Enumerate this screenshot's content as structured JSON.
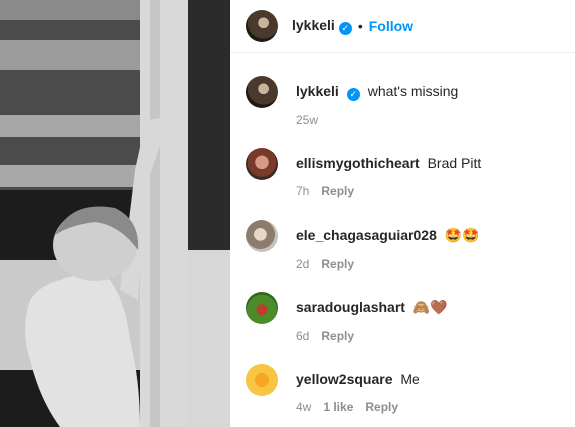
{
  "header": {
    "username": "lykkeli",
    "separator": "•",
    "follow_label": "Follow"
  },
  "caption": {
    "username": "lykkeli",
    "text": "what's missing",
    "time": "25w"
  },
  "comments": [
    {
      "username": "ellismygothicheart",
      "text": "Brad Pitt",
      "time": "7h",
      "likes": "",
      "reply_label": "Reply"
    },
    {
      "username": "ele_chagasaguiar028",
      "text": "🤩🤩",
      "time": "2d",
      "likes": "",
      "reply_label": "Reply"
    },
    {
      "username": "saradouglashart",
      "text": "🙈🤎",
      "time": "6d",
      "likes": "",
      "reply_label": "Reply"
    },
    {
      "username": "yellow2square",
      "text": "Me",
      "time": "4w",
      "likes": "1 like",
      "reply_label": "Reply"
    }
  ],
  "icons": {
    "verified": "verified-badge-icon"
  },
  "colors": {
    "accent": "#0095f6",
    "meta_text": "#8e8e8e",
    "text": "#262626"
  }
}
